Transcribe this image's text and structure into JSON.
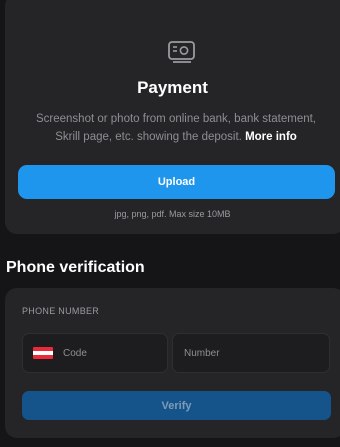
{
  "payment": {
    "icon": "payment-receipt-icon",
    "title": "Payment",
    "description": "Screenshot or photo from online bank, bank statement, Skrill page, etc. showing the deposit.",
    "more_info_label": "More info",
    "upload_label": "Upload",
    "hint": "jpg, png, pdf. Max size 10MB"
  },
  "phone_verification": {
    "title": "Phone verification",
    "field_label": "PHONE NUMBER",
    "code_placeholder": "Code",
    "country_flag": "austria-flag-icon",
    "number_placeholder": "Number",
    "verify_label": "Verify"
  },
  "colors": {
    "background": "#151517",
    "card": "#252528",
    "accent": "#1e96ee",
    "verify_disabled": "#14548a"
  }
}
